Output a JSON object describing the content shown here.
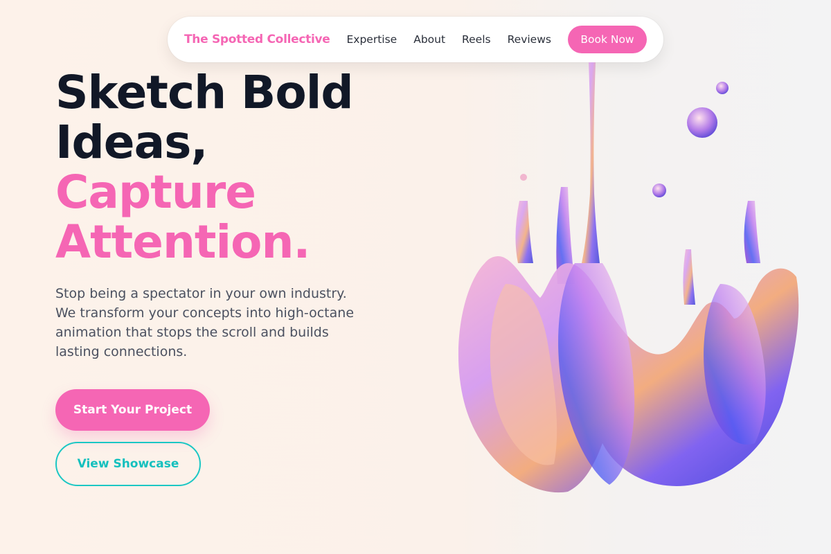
{
  "nav": {
    "brand": "The Spotted Collective",
    "links": [
      "Expertise",
      "About",
      "Reels",
      "Reviews"
    ],
    "cta": "Book Now"
  },
  "hero": {
    "title_line1": "Sketch Bold",
    "title_line2": "Ideas,",
    "title_line3": "Capture",
    "title_line4": "Attention.",
    "description": "Stop being a spectator in your own industry. We transform your concepts into high-octane animation that stops the scroll and builds lasting connections.",
    "primary_button": "Start Your Project",
    "secondary_button": "View Showcase"
  },
  "colors": {
    "accent_pink": "#f566b4",
    "accent_teal": "#1bc7c4",
    "heading_dark": "#111827"
  }
}
